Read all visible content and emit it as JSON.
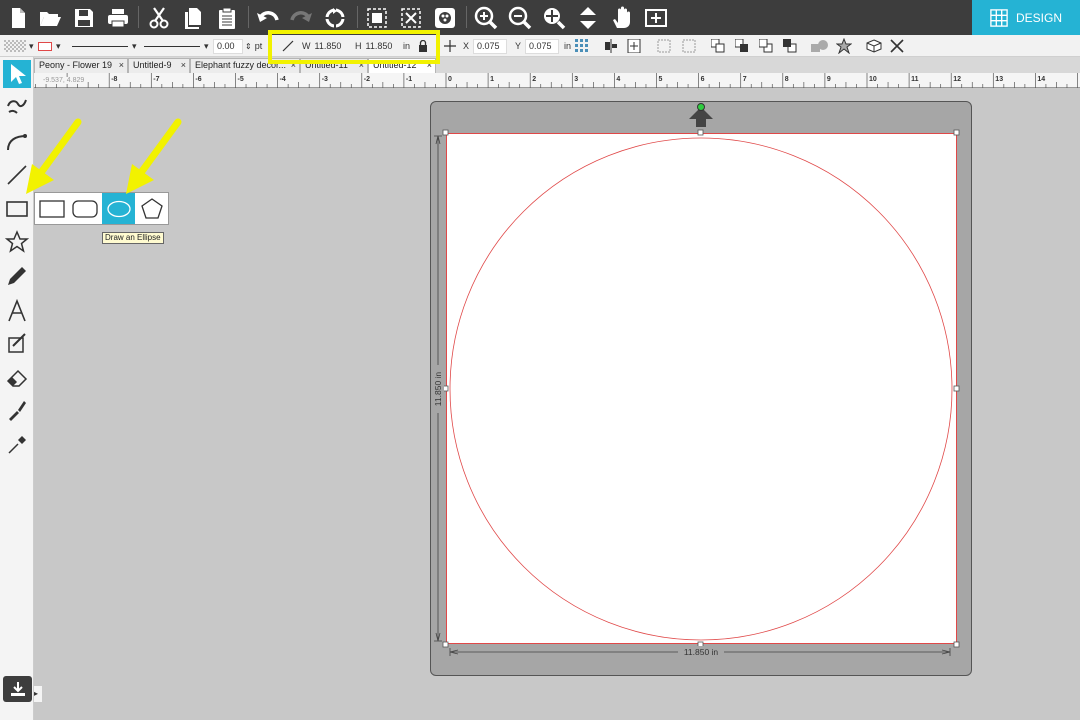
{
  "toolbar": {
    "design_label": "DESIGN",
    "icons": [
      "new-document-icon",
      "open-folder-icon",
      "save-icon",
      "print-icon",
      "cut-icon",
      "copy-icon",
      "paste-icon",
      "undo-icon",
      "redo-icon",
      "replicate-icon",
      "group-icon",
      "ungroup-icon",
      "fill-icon",
      "zoom-in-icon",
      "zoom-out-icon",
      "zoom-selection-icon",
      "pan-down-icon",
      "hand-icon",
      "fit-page-icon"
    ]
  },
  "properties": {
    "line_width": "0.00",
    "line_unit": "pt",
    "width_label": "W",
    "width_value": "11.850",
    "height_label": "H",
    "height_value": "11.850",
    "size_unit": "in",
    "x_label": "X",
    "x_value": "0.075",
    "y_label": "Y",
    "y_value": "0.075",
    "pos_unit": "in"
  },
  "tabs": [
    {
      "label": "Peony - Flower 19",
      "close": "×"
    },
    {
      "label": "Untitled-9",
      "close": "×"
    },
    {
      "label": "Elephant fuzzy decor...",
      "close": "×"
    },
    {
      "label": "Untitled-11",
      "close": "×"
    },
    {
      "label": "Untitled-12",
      "close": "×"
    }
  ],
  "ruler": {
    "coords": "-9.537, 4.829",
    "ticks": [
      "-8",
      "-7",
      "-6",
      "-5",
      "-4",
      "-3",
      "-2",
      "-1",
      "0",
      "1",
      "2",
      "3",
      "4",
      "5",
      "6",
      "7",
      "8",
      "9",
      "10",
      "11",
      "12",
      "13",
      "14"
    ]
  },
  "flyout": {
    "tooltip": "Draw an Ellipse",
    "items": [
      "rectangle-tool",
      "rounded-rectangle-tool",
      "ellipse-tool",
      "polygon-tool"
    ]
  },
  "canvas": {
    "width_dim": "11.850 in",
    "height_dim": "11.850 in"
  },
  "colors": {
    "accent": "#25b3d4",
    "highlight": "#f2f200",
    "shape_stroke": "#e04848",
    "toolbar_bg": "#3d3d3d"
  }
}
